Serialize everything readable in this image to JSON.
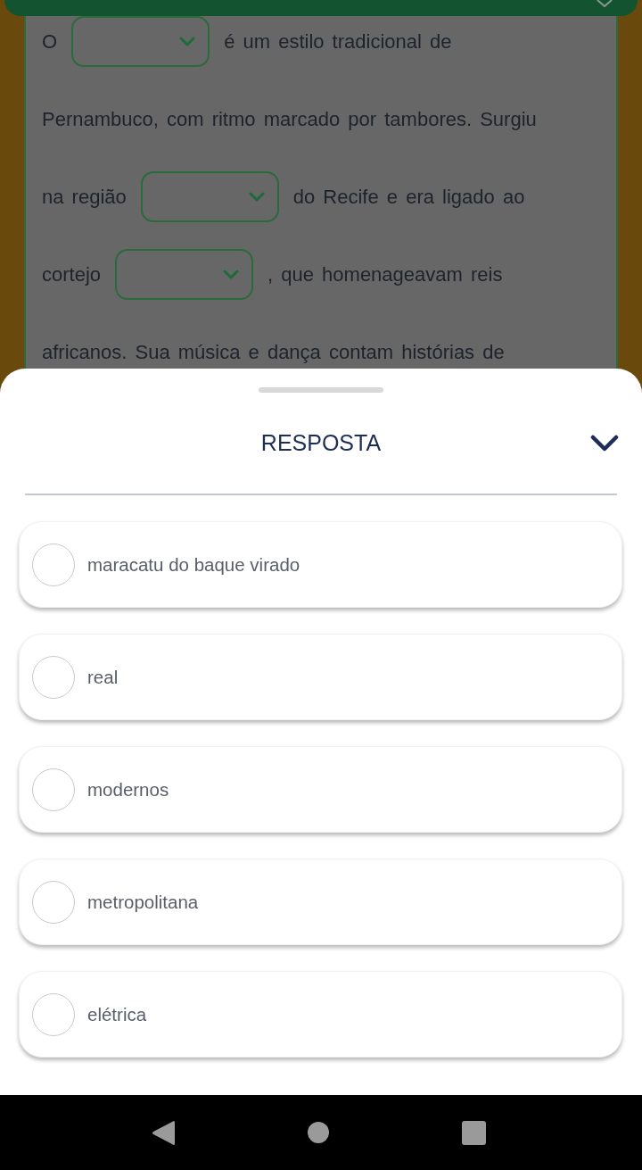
{
  "passage": {
    "lines": [
      [
        {
          "kind": "text",
          "text": "O"
        },
        {
          "kind": "dropdown"
        },
        {
          "kind": "text",
          "text": "é um estilo tradicional de"
        }
      ],
      [
        {
          "kind": "text",
          "text": "Pernambuco, com ritmo marcado por tambores. Surgiu"
        }
      ],
      [
        {
          "kind": "text",
          "text": "na região"
        },
        {
          "kind": "dropdown"
        },
        {
          "kind": "text",
          "text": "do Recife e era ligado ao"
        }
      ],
      [
        {
          "kind": "text",
          "text": "cortejo"
        },
        {
          "kind": "dropdown"
        },
        {
          "kind": "text",
          "text": ", que homenageavam reis"
        }
      ],
      [
        {
          "kind": "text",
          "text": "africanos. Sua música e dança contam histórias de"
        }
      ]
    ]
  },
  "answer_sheet": {
    "title": "RESPOSTA",
    "options": [
      {
        "label": "maracatu do baque virado",
        "selected": false
      },
      {
        "label": "real",
        "selected": false
      },
      {
        "label": "modernos",
        "selected": false
      },
      {
        "label": "metropolitana",
        "selected": false
      },
      {
        "label": "elétrica",
        "selected": false
      }
    ]
  }
}
